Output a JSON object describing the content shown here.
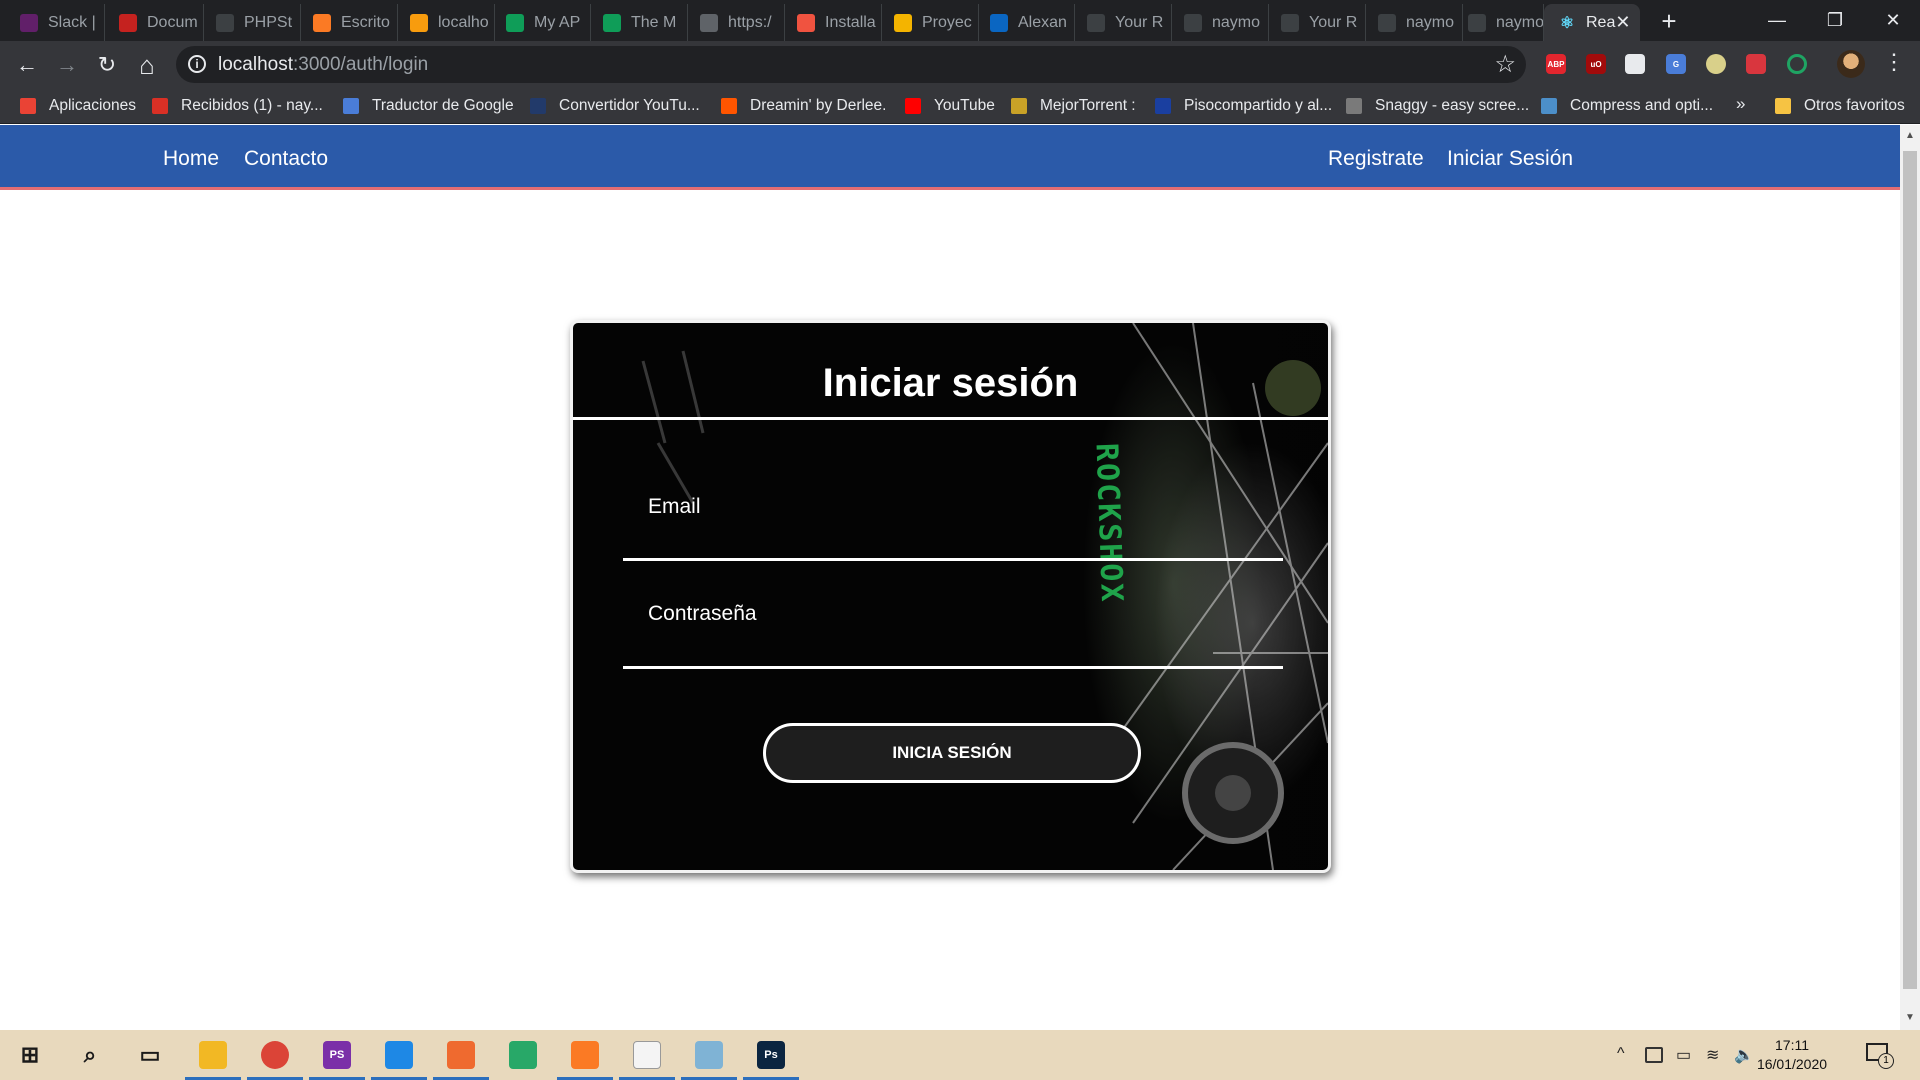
{
  "browser": {
    "tabs": [
      {
        "title": "Slack |",
        "icon": "slack-icon",
        "color": "#611f69"
      },
      {
        "title": "Docum",
        "icon": "document-icon",
        "color": "#c5221f"
      },
      {
        "title": "PHPSt",
        "icon": "github-icon",
        "color": "#3c4043"
      },
      {
        "title": "Escrito",
        "icon": "xampp-icon",
        "color": "#fb7a24"
      },
      {
        "title": "localho",
        "icon": "phpmyadmin-icon",
        "color": "#f89c0e"
      },
      {
        "title": "My AP",
        "icon": "sheet-icon",
        "color": "#0f9d58"
      },
      {
        "title": "The M",
        "icon": "sheet-icon",
        "color": "#0f9d58"
      },
      {
        "title": "https:/",
        "icon": "globe-icon",
        "color": "#5f6368"
      },
      {
        "title": "Installa",
        "icon": "laravel-icon",
        "color": "#f05340"
      },
      {
        "title": "Proyec",
        "icon": "slides-icon",
        "color": "#f4b400"
      },
      {
        "title": "Alexan",
        "icon": "linkedin-icon",
        "color": "#0a66c2"
      },
      {
        "title": "Your R",
        "icon": "github-icon",
        "color": "#3c4043"
      },
      {
        "title": "naymo",
        "icon": "github-icon",
        "color": "#3c4043"
      },
      {
        "title": "Your R",
        "icon": "github-icon",
        "color": "#3c4043"
      },
      {
        "title": "naymo",
        "icon": "github-icon",
        "color": "#3c4043"
      },
      {
        "title": "naymo",
        "icon": "github-icon",
        "color": "#3c4043"
      }
    ],
    "active_tab": {
      "title": "Rea",
      "icon": "react-icon",
      "close": "✕"
    },
    "new_tab": "+",
    "window_controls": {
      "minimize": "—",
      "restore": "❐",
      "close": "✕"
    },
    "nav": {
      "back": "←",
      "forward": "→",
      "reload": "↻",
      "home": "⌂"
    },
    "address": {
      "host": "localhost",
      "rest": ":3000/auth/login",
      "info": "i",
      "star": "☆"
    },
    "extensions": [
      {
        "name": "adblock-plus-icon",
        "label": "ABP",
        "color": "#e3262e"
      },
      {
        "name": "ublock-icon",
        "label": "uO",
        "color": "#a10b0b"
      },
      {
        "name": "document-ext-icon",
        "label": "",
        "color": "#e8eaed"
      },
      {
        "name": "google-translate-icon",
        "label": "G",
        "color": "#4a7dd8"
      },
      {
        "name": "bulb-ext-icon",
        "label": "",
        "color": "#d9d08a"
      },
      {
        "name": "red-grid-ext-icon",
        "label": "",
        "color": "#d9363e"
      },
      {
        "name": "green-ring-ext-icon",
        "label": "",
        "color": "#1fa463"
      }
    ],
    "menu": "⋮",
    "bookmarks": [
      {
        "label": "Aplicaciones",
        "icon": "apps-grid-icon",
        "color": "#ea4335"
      },
      {
        "label": "Recibidos (1) - nay...",
        "icon": "gmail-icon",
        "color": "#d93025"
      },
      {
        "label": "Traductor de Google",
        "icon": "google-translate-icon",
        "color": "#4a7dd8"
      },
      {
        "label": "Convertidor YouTu...",
        "icon": "convert-icon",
        "color": "#223a6a"
      },
      {
        "label": "Dreamin' by Derlee.",
        "icon": "soundcloud-icon",
        "color": "#ff5500"
      },
      {
        "label": "YouTube",
        "icon": "youtube-icon",
        "color": "#ff0000"
      },
      {
        "label": "MejorTorrent :",
        "icon": "torrent-icon",
        "color": "#c9a227"
      },
      {
        "label": "Pisocompartido y al...",
        "icon": "p-icon",
        "color": "#1a3fa0"
      },
      {
        "label": "Snaggy - easy scree...",
        "icon": "sg-icon",
        "color": "#7a7a7a"
      },
      {
        "label": "Compress and opti...",
        "icon": "compress-icon",
        "color": "#4c8fc9"
      }
    ],
    "bookmarks_more": "»",
    "other_bookmarks": {
      "label": "Otros favoritos",
      "icon": "folder-icon",
      "color": "#f6c343"
    }
  },
  "navbar": {
    "left": [
      "Home",
      "Contacto"
    ],
    "right": [
      "Registrate",
      "Iniciar Sesión"
    ],
    "colors": {
      "background": "#2b5aa9",
      "accent": "#e36d72"
    }
  },
  "login": {
    "title": "Iniciar sesión",
    "email_label": "Email",
    "email_value": "",
    "password_label": "Contraseña",
    "password_value": "",
    "submit_label": "INICIA SESIÓN",
    "background_text": "ROCKSHOX",
    "accent_color": "#1fa34a"
  },
  "taskbar": {
    "apps": [
      {
        "name": "start-button",
        "icon": "windows-icon",
        "label": "",
        "color": "#1a1a1a",
        "running": false
      },
      {
        "name": "search-button",
        "icon": "search-icon",
        "label": "",
        "color": "#1a1a1a",
        "running": false
      },
      {
        "name": "task-view-button",
        "icon": "task-view-icon",
        "label": "",
        "color": "#1a1a1a",
        "running": false
      },
      {
        "name": "file-explorer-button",
        "icon": "folder-icon",
        "label": "",
        "color": "#f2b824",
        "running": true
      },
      {
        "name": "chrome-button",
        "icon": "chrome-icon",
        "label": "",
        "color": "#db4437",
        "running": true
      },
      {
        "name": "phpstorm-button",
        "icon": "phpstorm-icon",
        "label": "PS",
        "color": "#7b2fa8",
        "running": true
      },
      {
        "name": "vscode-button",
        "icon": "vscode-icon",
        "label": "",
        "color": "#1e88e5",
        "running": true
      },
      {
        "name": "postman-button",
        "icon": "postman-icon",
        "label": "",
        "color": "#ef6a2f",
        "running": true
      },
      {
        "name": "gitkraken-button",
        "icon": "gitkraken-icon",
        "label": "",
        "color": "#28a868",
        "running": false
      },
      {
        "name": "xampp-button",
        "icon": "xampp-icon",
        "label": "",
        "color": "#fb7a24",
        "running": true
      },
      {
        "name": "dev-tool-button",
        "icon": "db-tool-icon",
        "label": "",
        "color": "#f4f4f4",
        "running": true
      },
      {
        "name": "notes-button",
        "icon": "notes-icon",
        "label": "",
        "color": "#7fb3d5",
        "running": true
      },
      {
        "name": "photoshop-button",
        "icon": "photoshop-icon",
        "label": "Ps",
        "color": "#0b2540",
        "running": true
      }
    ],
    "tray": {
      "chevron": "^",
      "battery": "▭",
      "wifi": "≋",
      "volume": "🔈"
    },
    "time": "17:11",
    "date": "16/01/2020",
    "notifications": "1"
  }
}
